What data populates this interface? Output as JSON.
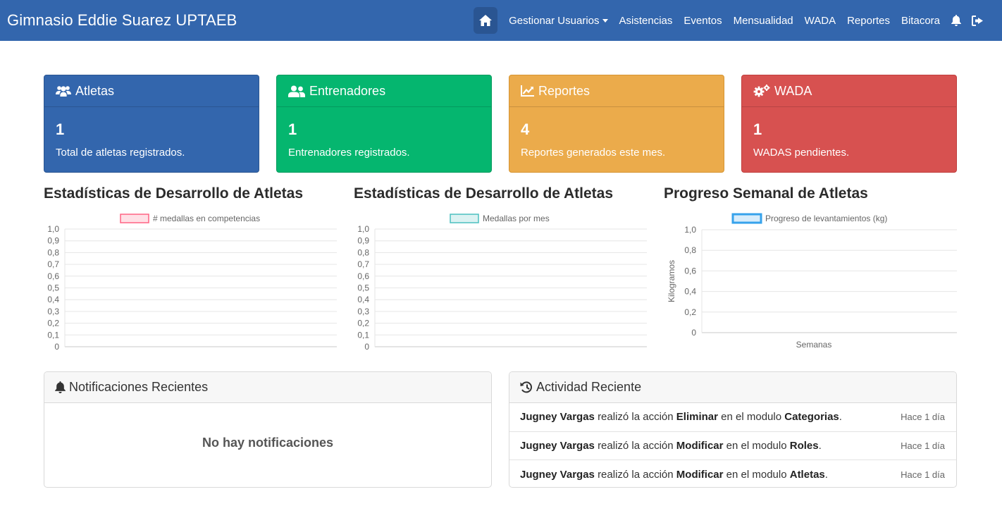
{
  "nav": {
    "brand": "Gimnasio Eddie Suarez UPTAEB",
    "home_icon": "home-icon",
    "links": [
      "Gestionar Usuarios",
      "Asistencias",
      "Eventos",
      "Mensualidad",
      "WADA",
      "Reportes",
      "Bitacora"
    ],
    "icons": [
      "bell-icon",
      "sign-out-icon"
    ]
  },
  "cards": [
    {
      "title": "Atletas",
      "value": "1",
      "desc": "Total de atletas registrados.",
      "icon": "users-icon",
      "color": "#3366ad"
    },
    {
      "title": "Entrenadores",
      "value": "1",
      "desc": "Entrenadores registrados.",
      "icon": "user-friends-icon",
      "color": "#05b66f"
    },
    {
      "title": "Reportes",
      "value": "4",
      "desc": "Reportes generados este mes.",
      "icon": "chart-line-icon",
      "color": "#ebab4b"
    },
    {
      "title": "WADA",
      "value": "1",
      "desc": "WADAS pendientes.",
      "icon": "cogs-icon",
      "color": "#d75150"
    }
  ],
  "chart_titles": [
    "Estadísticas de Desarrollo de Atletas",
    "Estadísticas de Desarrollo de Atletas",
    "Progreso Semanal de Atletas"
  ],
  "chart_data": [
    {
      "type": "bar",
      "legend": "# medallas en competencias",
      "legend_color": "#ff6384",
      "categories": [],
      "series": [
        {
          "name": "# medallas en competencias",
          "values": []
        }
      ],
      "yticks": [
        "1,0",
        "0,9",
        "0,8",
        "0,7",
        "0,6",
        "0,5",
        "0,4",
        "0,3",
        "0,2",
        "0,1",
        "0"
      ],
      "ylim": [
        0,
        1
      ],
      "grid": true
    },
    {
      "type": "bar",
      "legend": "Medallas por mes",
      "legend_color": "#4bc0c0",
      "categories": [],
      "series": [
        {
          "name": "Medallas por mes",
          "values": []
        }
      ],
      "yticks": [
        "1,0",
        "0,9",
        "0,8",
        "0,7",
        "0,6",
        "0,5",
        "0,4",
        "0,3",
        "0,2",
        "0,1",
        "0"
      ],
      "ylim": [
        0,
        1
      ],
      "grid": true
    },
    {
      "type": "line",
      "legend": "Progreso de levantamientos (kg)",
      "legend_color": "#36a2eb",
      "categories": [],
      "series": [
        {
          "name": "Progreso de levantamientos (kg)",
          "values": []
        }
      ],
      "yticks": [
        "1,0",
        "0,8",
        "0,6",
        "0,4",
        "0,2",
        "0"
      ],
      "ylim": [
        0,
        1
      ],
      "ylabel": "Kilogramos",
      "xlabel": "Semanas",
      "grid": true
    }
  ],
  "notifications": {
    "title": "Notificaciones Recientes",
    "icon": "bell-icon",
    "empty": "No hay notificaciones"
  },
  "activity": {
    "title": "Actividad Reciente",
    "icon": "history-icon",
    "word_performed": "realizó la acción",
    "word_module": "en el modulo",
    "items": [
      {
        "user": "Jugney Vargas",
        "action": "Eliminar",
        "module": "Categorias",
        "time": "Hace 1 día"
      },
      {
        "user": "Jugney Vargas",
        "action": "Modificar",
        "module": "Roles",
        "time": "Hace 1 día"
      },
      {
        "user": "Jugney Vargas",
        "action": "Modificar",
        "module": "Atletas",
        "time": "Hace 1 día"
      }
    ]
  }
}
